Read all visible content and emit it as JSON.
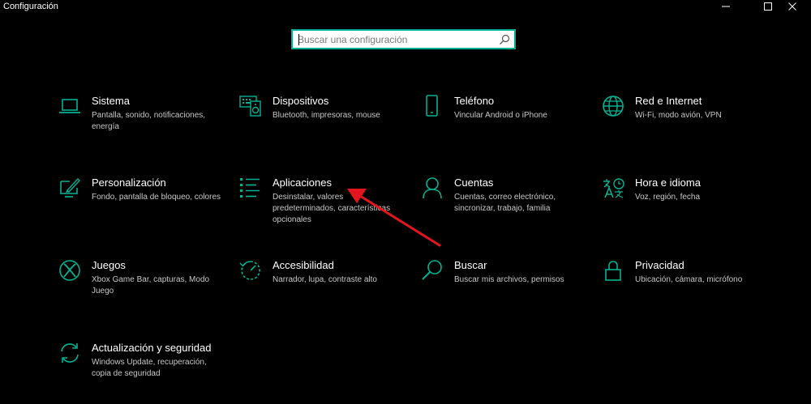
{
  "window": {
    "title": "Configuración"
  },
  "search": {
    "placeholder": "Buscar una configuración"
  },
  "accent_color": "#00b294",
  "annotation_color": "#e3161f",
  "tiles": [
    {
      "title": "Sistema",
      "desc": "Pantalla, sonido, notificaciones, energía",
      "icon": "laptop-icon"
    },
    {
      "title": "Dispositivos",
      "desc": "Bluetooth, impresoras, mouse",
      "icon": "devices-icon"
    },
    {
      "title": "Teléfono",
      "desc": "Vincular Android o iPhone",
      "icon": "phone-icon"
    },
    {
      "title": "Red e Internet",
      "desc": "Wi-Fi, modo avión, VPN",
      "icon": "globe-icon"
    },
    {
      "title": "Personalización",
      "desc": "Fondo, pantalla de bloqueo, colores",
      "icon": "paint-icon"
    },
    {
      "title": "Aplicaciones",
      "desc": "Desinstalar, valores predeterminados, características opcionales",
      "icon": "apps-list-icon"
    },
    {
      "title": "Cuentas",
      "desc": "Cuentas, correo electrónico, sincronizar, trabajo, familia",
      "icon": "person-icon"
    },
    {
      "title": "Hora e idioma",
      "desc": "Voz, región, fecha",
      "icon": "time-language-icon"
    },
    {
      "title": "Juegos",
      "desc": "Xbox Game Bar, capturas, Modo Juego",
      "icon": "xbox-icon"
    },
    {
      "title": "Accesibilidad",
      "desc": "Narrador, lupa, contraste alto",
      "icon": "accessibility-icon"
    },
    {
      "title": "Buscar",
      "desc": "Buscar mis archivos, permisos",
      "icon": "search-icon"
    },
    {
      "title": "Privacidad",
      "desc": "Ubicación, cámara, micrófono",
      "icon": "lock-icon"
    },
    {
      "title": "Actualización y seguridad",
      "desc": "Windows Update, recuperación, copia de seguridad",
      "icon": "update-icon"
    }
  ]
}
